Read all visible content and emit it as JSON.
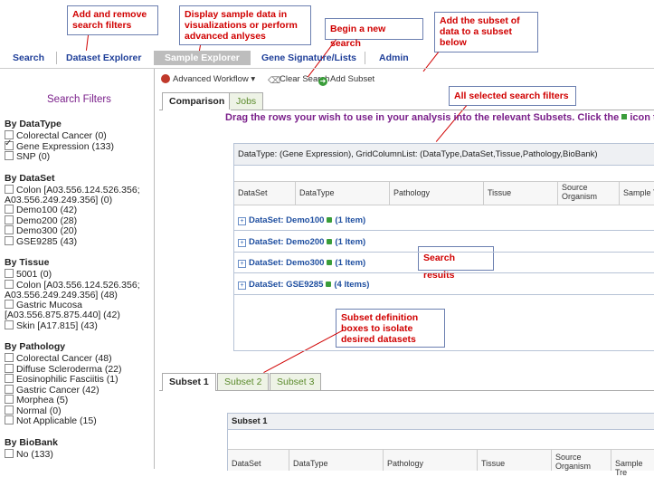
{
  "callouts": {
    "filters": "Add and remove search filters",
    "explorer": "Display sample data in visualizations or perform advanced anlyses",
    "new_search": "Begin a new search",
    "add_subset": "Add the subset of data to a subset below",
    "selected_filters": "All selected search filters",
    "search_results": "Search results",
    "subset_boxes": "Subset definition boxes to isolate desired datasets"
  },
  "nav": {
    "search": "Search",
    "dataset_explorer": "Dataset Explorer",
    "sample_explorer": "Sample Explorer",
    "gene_signature": "Gene Signature/Lists",
    "admin": "Admin"
  },
  "left": {
    "title": "Search Filters",
    "groups": [
      {
        "title": "By DataType",
        "items": [
          {
            "label": "Colorectal Cancer (0)",
            "checked": false
          },
          {
            "label": "Gene Expression (133)",
            "checked": true
          },
          {
            "label": "SNP (0)",
            "checked": false
          }
        ]
      },
      {
        "title": "By DataSet",
        "items": [
          {
            "label": "Colon [A03.556.124.526.356;",
            "label2": "A03.556.249.249.356] (0)",
            "checked": false
          },
          {
            "label": "Demo100 (42)",
            "checked": false
          },
          {
            "label": "Demo200 (28)",
            "checked": false
          },
          {
            "label": "Demo300 (20)",
            "checked": false
          },
          {
            "label": "GSE9285 (43)",
            "checked": false
          }
        ]
      },
      {
        "title": "By Tissue",
        "items": [
          {
            "label": "5001 (0)",
            "checked": false
          },
          {
            "label": "Colon [A03.556.124.526.356;",
            "label2": "A03.556.249.249.356] (48)",
            "checked": false
          },
          {
            "label": "Gastric Mucosa",
            "label2": "[A03.556.875.875.440] (42)",
            "checked": false
          },
          {
            "label": "Skin [A17.815] (43)",
            "checked": false
          }
        ]
      },
      {
        "title": "By Pathology",
        "items": [
          {
            "label": "Colorectal Cancer (48)",
            "checked": false
          },
          {
            "label": "Diffuse Scleroderma (22)",
            "checked": false
          },
          {
            "label": "Eosinophilic Fasciitis (1)",
            "checked": false
          },
          {
            "label": "Gastric Cancer (42)",
            "checked": false
          },
          {
            "label": "Morphea (5)",
            "checked": false
          },
          {
            "label": "Normal (0)",
            "checked": false
          },
          {
            "label": "Not Applicable (15)",
            "checked": false
          }
        ]
      },
      {
        "title": "By BioBank",
        "items": [
          {
            "label": "No (133)",
            "checked": false
          }
        ]
      }
    ]
  },
  "toolbar": {
    "advanced": "Advanced Workflow",
    "clear": "Clear Search",
    "add_subset": "Add Subset"
  },
  "tabs": [
    "Comparison",
    "Jobs"
  ],
  "instruction": "Drag the rows your wish to use in your analysis into the relevant Subsets. Click the",
  "instruction_tail": "icon to",
  "grid": {
    "header": "DataType: (Gene Expression), GridColumnList: (DataType,DataSet,Tissue,Pathology,BioBank)",
    "columns": [
      "DataSet",
      "DataType",
      "Pathology",
      "Tissue",
      "Source Organism",
      "Sample Tr"
    ],
    "rows": [
      {
        "label": "DataSet: Demo100",
        "count": "(1 Item)"
      },
      {
        "label": "DataSet: Demo200",
        "count": "(1 Item)"
      },
      {
        "label": "DataSet: Demo300",
        "count": "(1 Item)"
      },
      {
        "label": "DataSet: GSE9285",
        "count": "(4 Items)"
      }
    ]
  },
  "subset_tabs": [
    "Subset 1",
    "Subset 2",
    "Subset 3"
  ],
  "subset_panel": {
    "header": "Subset 1",
    "columns": [
      "DataSet",
      "DataType",
      "Pathology",
      "Tissue",
      "Source Organism",
      "Sample Tre"
    ]
  },
  "colors": {
    "callout_text": "#d00000",
    "purple": "#7a1f8a",
    "link_blue": "#1f3f99"
  }
}
